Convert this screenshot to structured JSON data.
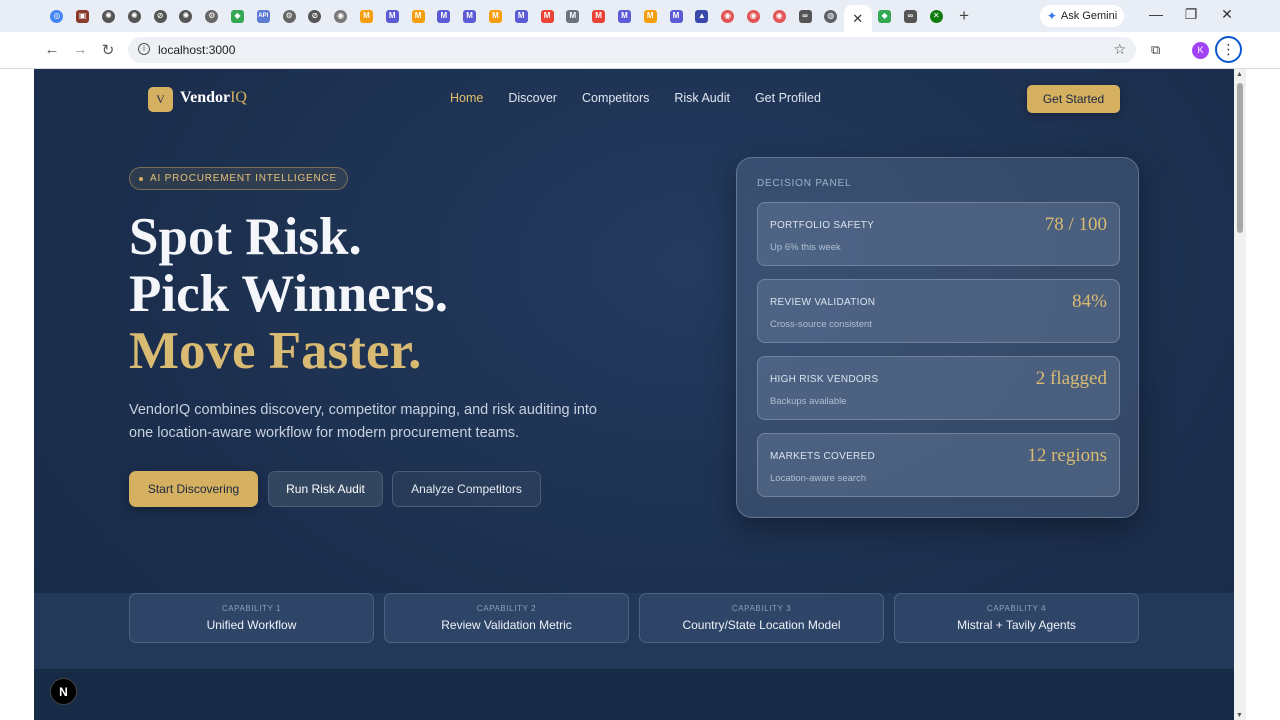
{
  "browser": {
    "tab_favicons": [
      {
        "name": "chromium-icon",
        "color": "#4285f4",
        "glyph": "◎",
        "round": true
      },
      {
        "name": "app-icon",
        "color": "#8b3a2b",
        "glyph": "▣",
        "round": false
      },
      {
        "name": "openai-icon",
        "color": "#555555",
        "glyph": "✺",
        "round": true
      },
      {
        "name": "openai-icon",
        "color": "#555555",
        "glyph": "✺",
        "round": true
      },
      {
        "name": "openai-icon",
        "color": "#555555",
        "glyph": "⊘",
        "round": true
      },
      {
        "name": "openai-icon",
        "color": "#555555",
        "glyph": "✺",
        "round": true
      },
      {
        "name": "settings-icon",
        "color": "#666666",
        "glyph": "⚙",
        "round": true
      },
      {
        "name": "maps-icon",
        "color": "#34a853",
        "glyph": "◆",
        "round": false
      },
      {
        "name": "api-icon",
        "color": "#5b7bd5",
        "glyph": "API",
        "round": false
      },
      {
        "name": "settings-icon",
        "color": "#666666",
        "glyph": "⚙",
        "round": true
      },
      {
        "name": "openai-icon",
        "color": "#555555",
        "glyph": "⊘",
        "round": true
      },
      {
        "name": "chrome-icon",
        "color": "#777777",
        "glyph": "◉",
        "round": true
      },
      {
        "name": "mistral-icon",
        "color": "#f59e0b",
        "glyph": "M",
        "round": false
      },
      {
        "name": "m-icon",
        "color": "#5b5bd6",
        "glyph": "M",
        "round": false
      },
      {
        "name": "mistral-icon",
        "color": "#f59e0b",
        "glyph": "M",
        "round": false
      },
      {
        "name": "m-icon",
        "color": "#5b5bd6",
        "glyph": "M",
        "round": false
      },
      {
        "name": "m-icon",
        "color": "#5b5bd6",
        "glyph": "M",
        "round": false
      },
      {
        "name": "mistral-icon",
        "color": "#f59e0b",
        "glyph": "M",
        "round": false
      },
      {
        "name": "m-icon",
        "color": "#5b5bd6",
        "glyph": "M",
        "round": false
      },
      {
        "name": "gmail-icon",
        "color": "#ea4335",
        "glyph": "M",
        "round": false
      },
      {
        "name": "m-icon",
        "color": "#6b7280",
        "glyph": "M",
        "round": false
      },
      {
        "name": "gmail-icon",
        "color": "#ea4335",
        "glyph": "M",
        "round": false
      },
      {
        "name": "m-icon",
        "color": "#5b5bd6",
        "glyph": "M",
        "round": false
      },
      {
        "name": "mistral-icon",
        "color": "#f59e0b",
        "glyph": "M",
        "round": false
      },
      {
        "name": "m-icon",
        "color": "#5b5bd6",
        "glyph": "M",
        "round": false
      },
      {
        "name": "vercel-icon",
        "color": "#3949ab",
        "glyph": "▲",
        "round": false
      },
      {
        "name": "notification-icon",
        "color": "#e25555",
        "glyph": "◉",
        "round": true
      },
      {
        "name": "notification-icon",
        "color": "#e25555",
        "glyph": "◉",
        "round": true
      },
      {
        "name": "notification-icon",
        "color": "#e25555",
        "glyph": "◉",
        "round": true
      },
      {
        "name": "infinity-icon",
        "color": "#555555",
        "glyph": "∞",
        "round": false
      },
      {
        "name": "globe-icon",
        "color": "#5f6368",
        "glyph": "◍",
        "round": true
      }
    ],
    "tab_favicons_after": [
      {
        "name": "maps-icon",
        "color": "#34a853",
        "glyph": "◆",
        "round": false
      },
      {
        "name": "infinity-icon",
        "color": "#555555",
        "glyph": "∞",
        "round": false
      },
      {
        "name": "xbox-icon",
        "color": "#107c10",
        "glyph": "✕",
        "round": true
      }
    ],
    "active_tab_close": "✕",
    "new_tab": "+",
    "gemini_label": "Ask Gemini",
    "url": "localhost:3000",
    "profile_initial": "K"
  },
  "site": {
    "logo_mark": "V",
    "logo_text_main": "Vendor",
    "logo_text_accent": "IQ",
    "nav": [
      "Home",
      "Discover",
      "Competitors",
      "Risk Audit",
      "Get Profiled"
    ],
    "cta": "Get Started"
  },
  "hero": {
    "pill": "AI PROCUREMENT INTELLIGENCE",
    "line1": "Spot Risk.",
    "line2": "Pick Winners.",
    "line3": "Move Faster.",
    "lede": "VendorIQ combines discovery, competitor mapping, and risk auditing into one location-aware workflow for modern procurement teams.",
    "btn_primary": "Start Discovering",
    "btn_secondary": "Run Risk Audit",
    "btn_ghost": "Analyze Competitors"
  },
  "panel": {
    "title": "DECISION PANEL",
    "cards": [
      {
        "label": "PORTFOLIO SAFETY",
        "sub": "Up 6% this week",
        "value": "78 / 100"
      },
      {
        "label": "REVIEW VALIDATION",
        "sub": "Cross-source consistent",
        "value": "84%"
      },
      {
        "label": "HIGH RISK VENDORS",
        "sub": "Backups available",
        "value": "2 flagged"
      },
      {
        "label": "MARKETS COVERED",
        "sub": "Location-aware search",
        "value": "12 regions"
      }
    ]
  },
  "capabilities": [
    {
      "label": "CAPABILITY 1",
      "name": "Unified Workflow"
    },
    {
      "label": "CAPABILITY 2",
      "name": "Review Validation Metric"
    },
    {
      "label": "CAPABILITY 3",
      "name": "Country/State Location Model"
    },
    {
      "label": "CAPABILITY 4",
      "name": "Mistral + Tavily Agents"
    }
  ],
  "dev_badge": "N"
}
